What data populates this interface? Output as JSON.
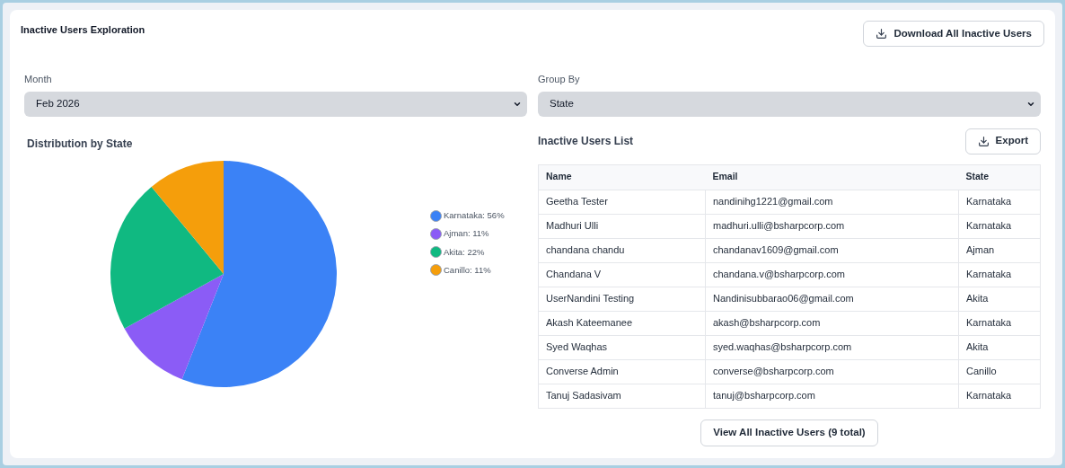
{
  "title": "Inactive Users Exploration",
  "download_button": "Download All Inactive Users",
  "filters": [
    {
      "label": "Month",
      "value": "Feb 2026"
    },
    {
      "label": "Group By",
      "value": "State"
    }
  ],
  "distribution": {
    "title": "Distribution by State",
    "chart_data": {
      "type": "pie",
      "categories": [
        "Karnataka: 56%",
        "Ajman: 11%",
        "Akita: 22%",
        "Canillo: 11%"
      ],
      "values": [
        56,
        11,
        22,
        11
      ],
      "colors": [
        "#3b82f6",
        "#8b5cf6",
        "#10b981",
        "#f59e0b"
      ]
    }
  },
  "users_list": {
    "title": "Inactive Users List",
    "export_button": "Export",
    "columns": [
      "Name",
      "Email",
      "State"
    ],
    "rows": [
      [
        "Geetha Tester",
        "nandinihg1221@gmail.com",
        "Karnataka"
      ],
      [
        "Madhuri Ulli",
        "madhuri.ulli@bsharpcorp.com",
        "Karnataka"
      ],
      [
        "chandana chandu",
        "chandanav1609@gmail.com",
        "Ajman"
      ],
      [
        "Chandana V",
        "chandana.v@bsharpcorp.com",
        "Karnataka"
      ],
      [
        "UserNandini Testing",
        "Nandinisubbarao06@gmail.com",
        "Akita"
      ],
      [
        "Akash Kateemanee",
        "akash@bsharpcorp.com",
        "Karnataka"
      ],
      [
        "Syed Waqhas",
        "syed.waqhas@bsharpcorp.com",
        "Akita"
      ],
      [
        "Converse Admin",
        "converse@bsharpcorp.com",
        "Canillo"
      ],
      [
        "Tanuj Sadasivam",
        "tanuj@bsharpcorp.com",
        "Karnataka"
      ]
    ],
    "view_all_button": "View All Inactive Users (9 total)"
  }
}
